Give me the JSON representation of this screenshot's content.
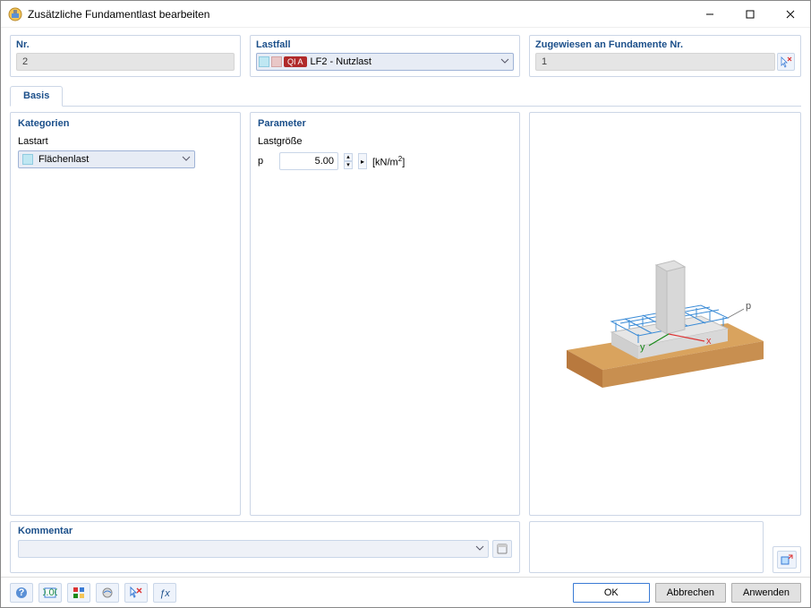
{
  "window": {
    "title": "Zusätzliche Fundamentlast bearbeiten"
  },
  "top": {
    "nr_label": "Nr.",
    "nr_value": "2",
    "lastfall_label": "Lastfall",
    "lastfall_tag": "QI A",
    "lastfall_value": "LF2 - Nutzlast",
    "assigned_label": "Zugewiesen an Fundamente Nr.",
    "assigned_value": "1"
  },
  "tabs": {
    "basis": "Basis"
  },
  "categories": {
    "title": "Kategorien",
    "lastart_label": "Lastart",
    "lastart_value": "Flächenlast"
  },
  "parameters": {
    "title": "Parameter",
    "lastgroesse_label": "Lastgröße",
    "p_symbol": "p",
    "p_value": "5.00",
    "p_unit_prefix": "[kN/m",
    "p_unit_sup": "2",
    "p_unit_suffix": "]"
  },
  "preview": {
    "p_label": "p",
    "x": "x",
    "y": "y"
  },
  "comment": {
    "title": "Kommentar",
    "value": ""
  },
  "buttons": {
    "ok": "OK",
    "cancel": "Abbrechen",
    "apply": "Anwenden"
  }
}
